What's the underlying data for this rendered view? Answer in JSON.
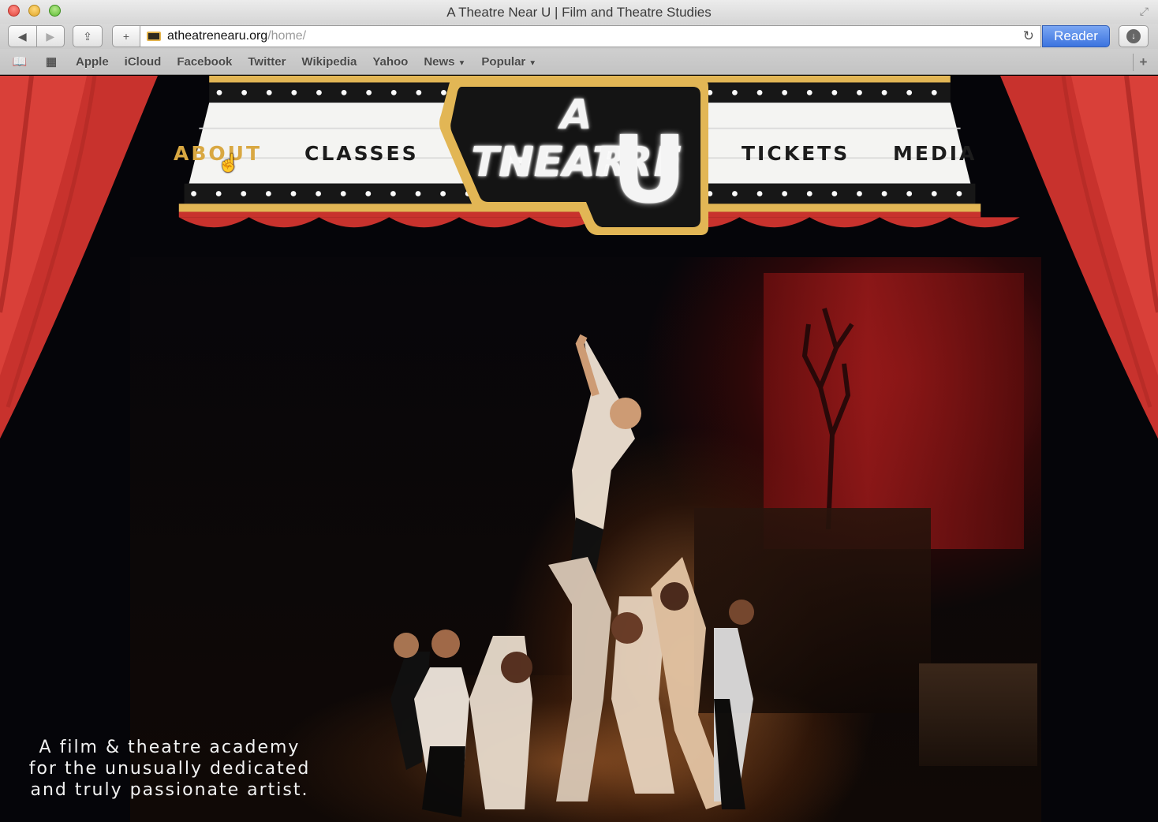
{
  "window": {
    "title": "A Theatre Near U | Film and Theatre Studies"
  },
  "toolbar": {
    "url_domain": "atheatrenearu.org",
    "url_path": "/home/",
    "reader_label": "Reader"
  },
  "bookmarks": {
    "items": [
      "Apple",
      "iCloud",
      "Facebook",
      "Twitter",
      "Wikipedia",
      "Yahoo",
      "News",
      "Popular"
    ]
  },
  "site": {
    "logo": {
      "line1": "A THEATRE",
      "line2": "NEAR",
      "line3": "U"
    },
    "nav": {
      "about": "ABOUT",
      "classes": "CLASSES",
      "tickets": "TICKETS",
      "media": "MEDIA",
      "active": "about"
    },
    "tagline": [
      "A film & theatre academy",
      "for the unusually dedicated",
      "and truly passionate artist."
    ]
  },
  "colors": {
    "accent_gold": "#d9a842",
    "curtain_red": "#c9302c",
    "marquee_dark": "#141414"
  }
}
